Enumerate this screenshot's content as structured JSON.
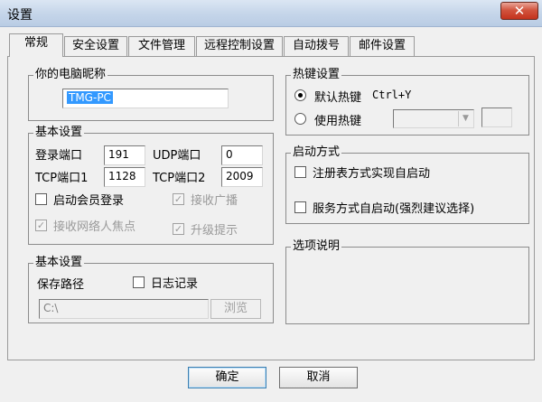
{
  "window": {
    "title": "设置",
    "close_label": "✕"
  },
  "tabs": [
    "常规",
    "安全设置",
    "文件管理",
    "远程控制设置",
    "自动拨号",
    "邮件设置"
  ],
  "nickname": {
    "legend": "你的电脑昵称",
    "value": "TMG-PC"
  },
  "basic_ports": {
    "legend": "基本设置",
    "login_port_label": "登录端口",
    "login_port_value": "191",
    "udp_port_label": "UDP端口",
    "udp_port_value": "0",
    "tcp1_label": "TCP端口1",
    "tcp1_value": "1128",
    "tcp2_label": "TCP端口2",
    "tcp2_value": "2009",
    "member_login_label": "启动会员登录",
    "receive_broadcast_label": "接收广播",
    "receive_network_label": "接收网络人焦点",
    "upgrade_hint_label": "升级提示"
  },
  "basic_log": {
    "legend": "基本设置",
    "save_path_label": "保存路径",
    "log_label": "日志记录",
    "path_value": "C:\\",
    "browse_label": "浏览"
  },
  "hotkey": {
    "legend": "热键设置",
    "default_label": "默认热键",
    "default_value": "Ctrl+Y",
    "custom_label": "使用热键"
  },
  "startup": {
    "legend": "启动方式",
    "registry_label": "注册表方式实现自启动",
    "service_label": "服务方式自启动(强烈建议选择)"
  },
  "options": {
    "legend": "选项说明"
  },
  "footer": {
    "ok_label": "确定",
    "cancel_label": "取消"
  }
}
